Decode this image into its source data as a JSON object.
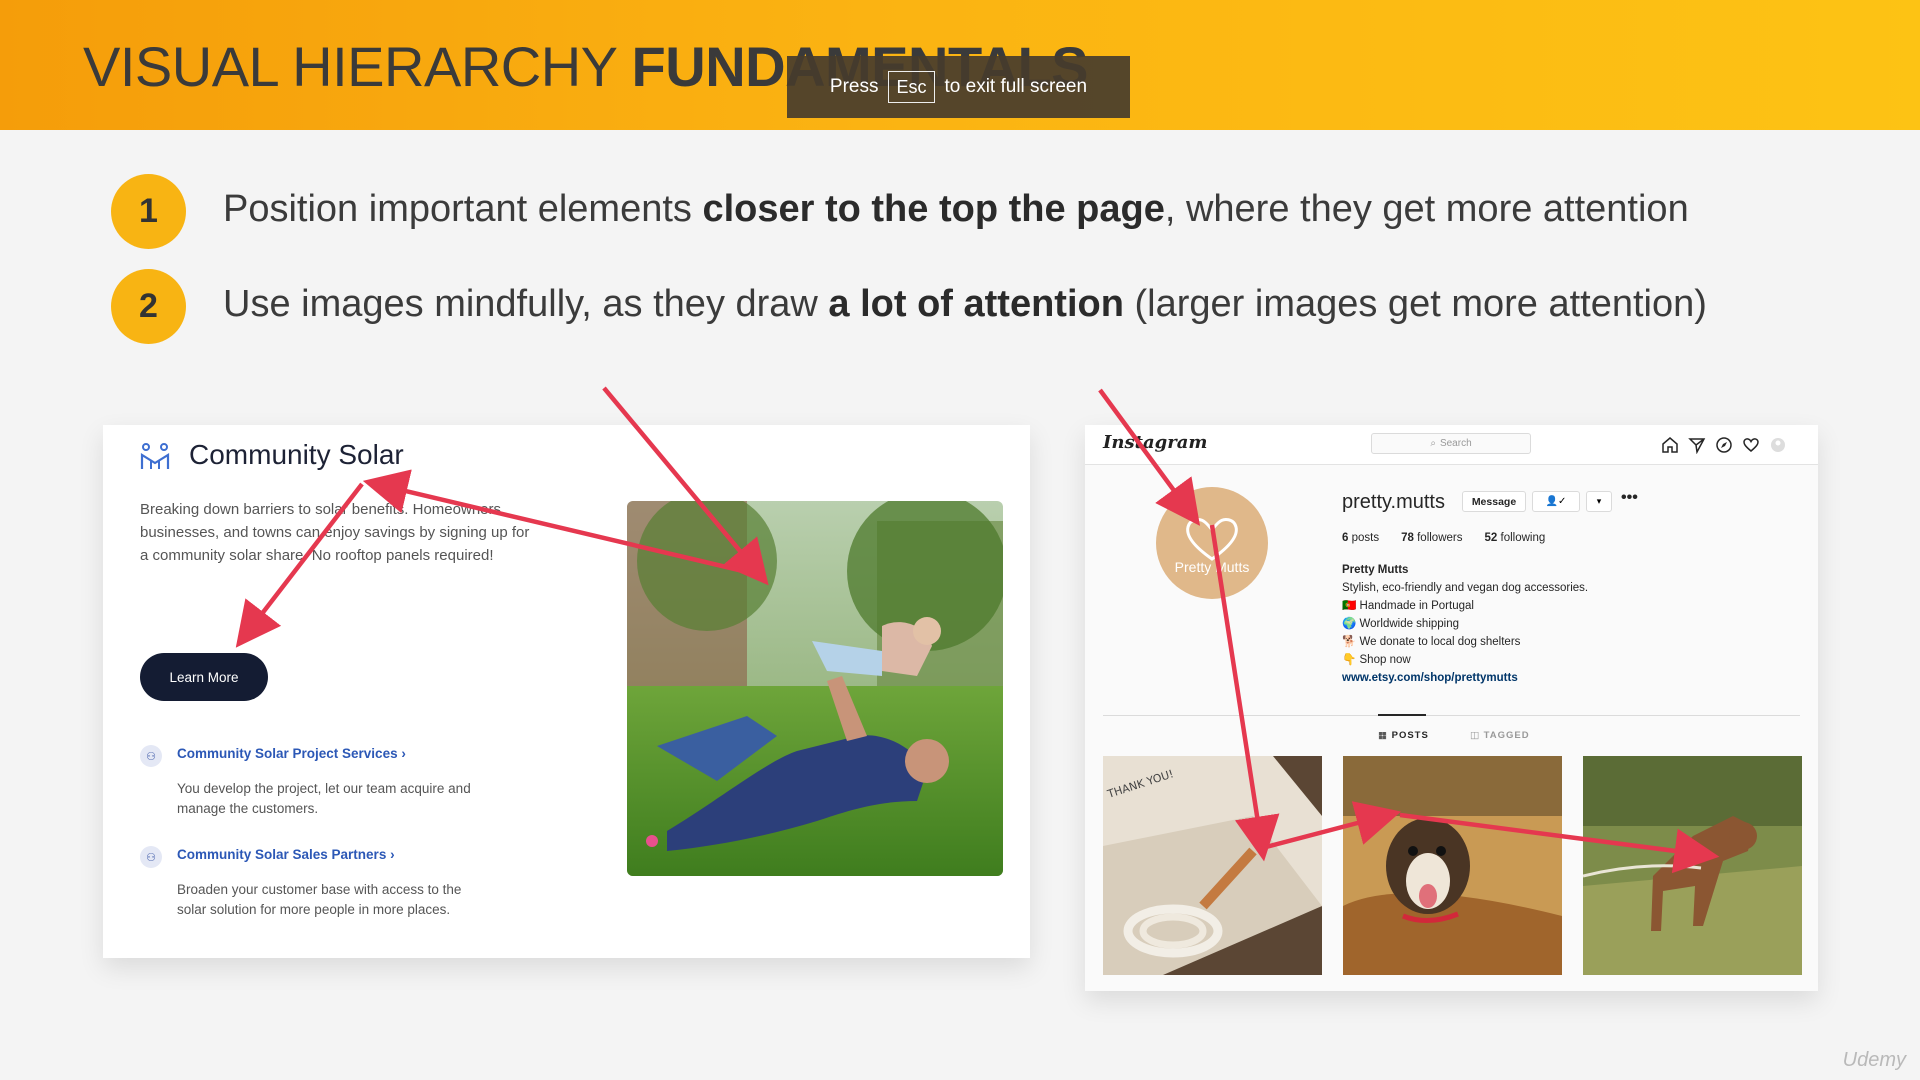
{
  "slide": {
    "title_normal": "VISUAL HIERARCHY ",
    "title_bold": "FUNDAMENTALS",
    "watermark": "Udemy"
  },
  "fullscreen_toast": {
    "press": "Press",
    "key": "Esc",
    "rest": "to exit full screen"
  },
  "points": [
    {
      "number": "1",
      "before": "Position important elements ",
      "bold": "closer to the top the page",
      "after": ", where they get more attention"
    },
    {
      "number": "2",
      "before": "Use images mindfully, as they draw ",
      "bold": "a lot of attention",
      "after": " (larger images get more attention)"
    }
  ],
  "community_solar": {
    "title": "Community Solar",
    "description": "Breaking down barriers to solar benefits. Homeowners, businesses, and towns can enjoy savings by signing up for a community solar share. No rooftop panels required!",
    "button": "Learn More",
    "services": [
      {
        "link": "Community Solar Project Services ›",
        "text": "You develop the project, let our team acquire and manage the customers."
      },
      {
        "link": "Community Solar Sales Partners ›",
        "text": "Broaden your customer base with access to the solar solution for more people in more places."
      }
    ]
  },
  "instagram": {
    "logo": "Instagram",
    "search_placeholder": "Search",
    "username": "pretty.mutts",
    "avatar_text": "Pretty Mutts",
    "message_button": "Message",
    "follow_icon": "👤✓",
    "dropdown": "▾",
    "more": "•••",
    "posts": "6",
    "posts_label": "posts",
    "followers": "78",
    "followers_label": "followers",
    "following": "52",
    "following_label": "following",
    "bio_name": "Pretty Mutts",
    "bio_lines": [
      "Stylish, eco-friendly and vegan dog accessories.",
      "🇵🇹 Handmade in Portugal",
      "🌍 Worldwide shipping",
      "🐕 We donate to local dog shelters",
      "👇 Shop now"
    ],
    "bio_link": "www.etsy.com/shop/prettymutts",
    "tab_posts": "POSTS",
    "tab_tagged": "TAGGED",
    "thumb1_text": "THANK YOU!"
  },
  "colors": {
    "accent": "#f8b413",
    "arrow": "#e5384f",
    "button_dark": "#141c33",
    "link_blue": "#2c58b6"
  }
}
